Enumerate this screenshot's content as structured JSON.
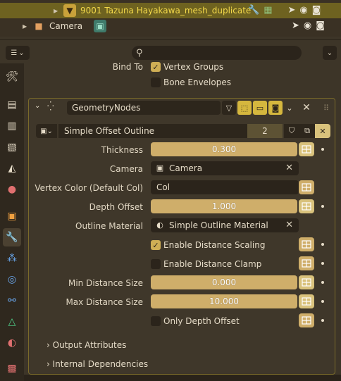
{
  "outliner": {
    "object_name": "9001 Tazuna Hayakawa_mesh_duplicate",
    "camera_name": "Camera"
  },
  "bind_to": {
    "label": "Bind To",
    "vertex_groups": "Vertex Groups",
    "bone_envelopes": "Bone Envelopes"
  },
  "modifier": {
    "name": "GeometryNodes",
    "node_group": "Simple Offset Outline",
    "users": "2"
  },
  "fields": {
    "thickness": {
      "label": "Thickness",
      "value": "0.300"
    },
    "camera": {
      "label": "Camera",
      "value": "Camera"
    },
    "vertex_color": {
      "label": "Vertex Color (Default Col)",
      "value": "Col"
    },
    "depth_offset": {
      "label": "Depth Offset",
      "value": "1.000"
    },
    "outline_material": {
      "label": "Outline Material",
      "value": "Simple Outline Material"
    },
    "enable_distance_scaling": "Enable Distance Scaling",
    "enable_distance_clamp": "Enable Distance Clamp",
    "min_distance_size": {
      "label": "Min Distance Size",
      "value": "0.000"
    },
    "max_distance_size": {
      "label": "Max Distance Size",
      "value": "10.000"
    },
    "only_depth_offset": "Only Depth Offset"
  },
  "subpanels": {
    "output_attributes": "Output Attributes",
    "internal_dependencies": "Internal Dependencies"
  },
  "colors": {
    "accent": "#cfae6a",
    "selected_row": "#6e6220",
    "panel_border": "#7a6a2a"
  }
}
